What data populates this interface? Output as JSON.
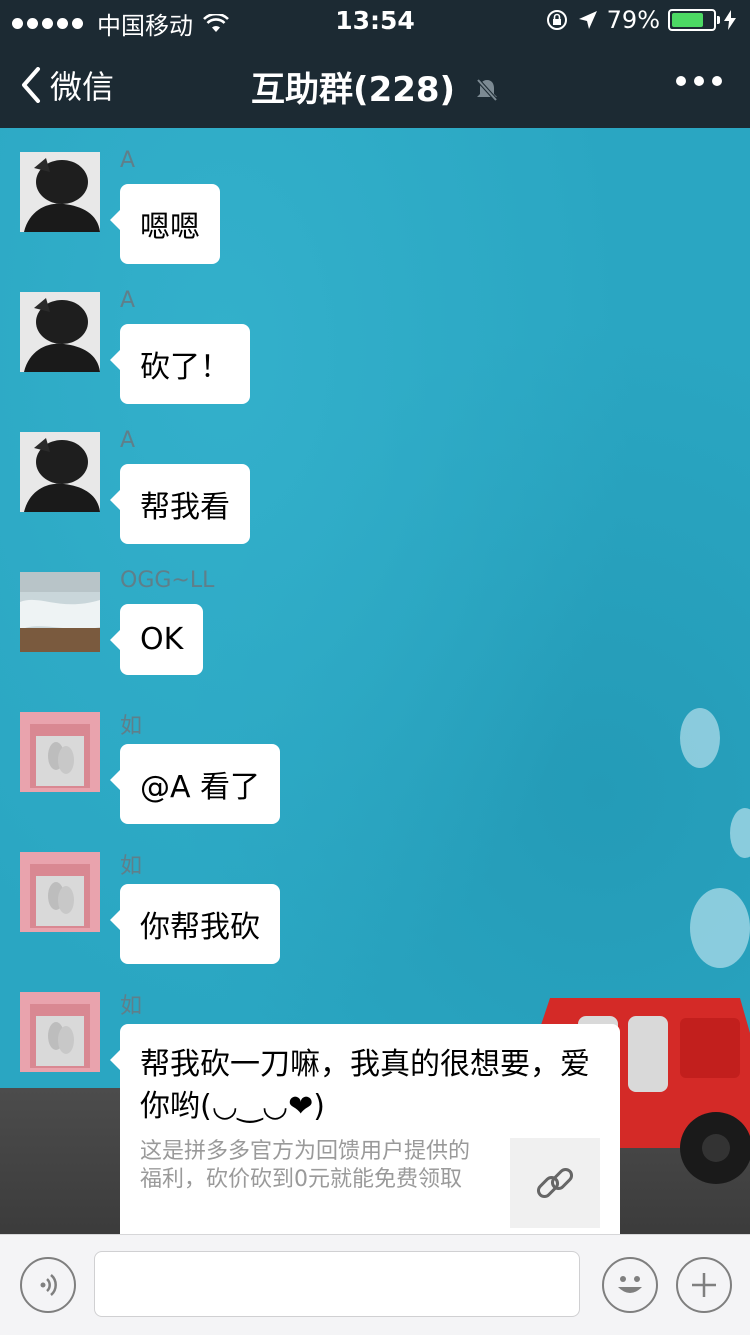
{
  "status_bar": {
    "carrier": "中国移动",
    "time": "13:54",
    "battery": "79%",
    "battery_level": 0.79
  },
  "nav": {
    "back_label": "微信",
    "title": "互助群(228)",
    "title_icon": "mute-icon",
    "more_icon": "more-icon"
  },
  "messages": [
    {
      "sender": "A",
      "text": "嗯嗯",
      "avatar": "avatar-a"
    },
    {
      "sender": "A",
      "text": "砍了！",
      "avatar": "avatar-a"
    },
    {
      "sender": "A",
      "text": "帮我看",
      "avatar": "avatar-a"
    },
    {
      "sender": "OGG~LL",
      "text": "OK",
      "avatar": "avatar-ogg"
    },
    {
      "sender": "如",
      "text": "@A 看了",
      "avatar": "avatar-ru"
    },
    {
      "sender": "如",
      "text": "你帮我砍",
      "avatar": "avatar-ru"
    },
    {
      "sender": "如",
      "avatar": "avatar-ru",
      "card_title": "帮我砍一刀嘛，我真的很想要，爱你哟(◡‿◡❤)",
      "card_desc": "这是拼多多官方为回馈用户提供的福利，砍价砍到0元就能免费领取",
      "card_icon": "link-icon"
    }
  ],
  "input_bar": {
    "voice_icon": "voice-icon",
    "input_value": "",
    "emoji_icon": "emoji-icon",
    "plus_icon": "plus-icon"
  },
  "colors": {
    "nav_bg": "#1c2a33",
    "chat_bg": "#2aa6c2",
    "bubble": "#ffffff",
    "sender": "#5f7f8a",
    "battery_fill": "#4cd964"
  }
}
